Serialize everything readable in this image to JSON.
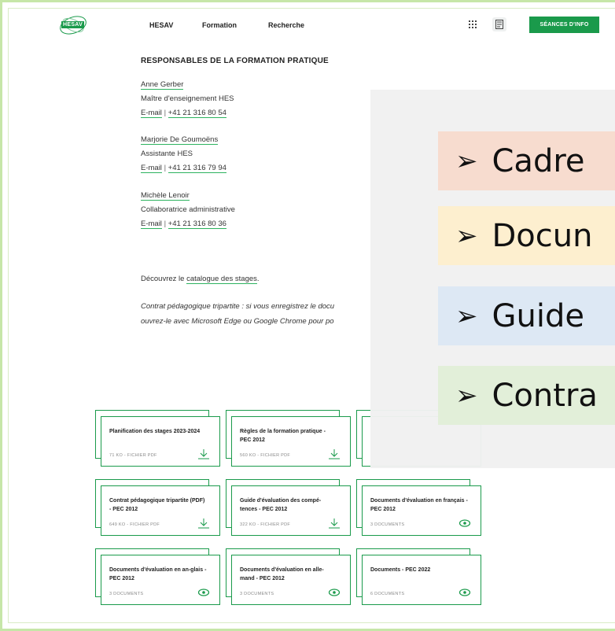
{
  "header": {
    "logo_text": "HESAV",
    "nav": [
      "HESAV",
      "Formation",
      "Recherche"
    ],
    "cta_label": "SÉANCES D'INFO"
  },
  "main": {
    "heading": "RESPONSABLES DE LA FORMATION PRATIQUE",
    "contacts": [
      {
        "name": "Anne Gerber",
        "role": "Maître d'enseignement HES",
        "email": "E-mail",
        "sep": "|",
        "phone": "+41 21 316 80 54"
      },
      {
        "name": "Marjorie De Goumoëns",
        "role": "Assistante HES",
        "email": "E-mail",
        "sep": "|",
        "phone": "+41 21 316 79 94"
      },
      {
        "name": "Michèle Lenoir",
        "role": "Collaboratrice administrative",
        "email": "E-mail",
        "sep": "|",
        "phone": "+41 21 316 80 36"
      }
    ],
    "catalogue": {
      "prefix": "Découvrez le ",
      "link": "catalogue des stages",
      "suffix": "."
    },
    "note_line1": "Contrat pédagogique tripartite : si vous enregistrez le docu",
    "note_line2": "ouvrez-le avec Microsoft Edge ou Google Chrome pour po"
  },
  "overlay": {
    "bullets": [
      "Cadre",
      "Docun",
      "Guide",
      "Contra"
    ],
    "colors": [
      "#f7dccf",
      "#fdefcf",
      "#dde8f4",
      "#e2efd9"
    ]
  },
  "cards": [
    {
      "title": "Planification des stages 2023-2024",
      "meta": "71 KO - FICHIER PDF",
      "icon": "download-icon"
    },
    {
      "title": "Règles de la formation pratique - PEC 2012",
      "meta": "560 KO - FICHIER PDF",
      "icon": "download-icon"
    },
    {
      "title": "",
      "meta": "",
      "icon": ""
    },
    {
      "title": "Contrat pédagogique tripartite (PDF) - PEC 2012",
      "meta": "649 KO - FICHIER PDF",
      "icon": "download-icon"
    },
    {
      "title": "Guide d'évaluation des compé-tences - PEC 2012",
      "meta": "322 KO - FICHIER PDF",
      "icon": "download-icon"
    },
    {
      "title": "Documents d'évaluation en français - PEC 2012",
      "meta": "3 DOCUMENTS",
      "icon": "eye-icon"
    },
    {
      "title": "Documents d'évaluation en an-glais - PEC 2012",
      "meta": "3 DOCUMENTS",
      "icon": "eye-icon"
    },
    {
      "title": "Documents d'évaluation en alle-mand - PEC 2012",
      "meta": "3 DOCUMENTS",
      "icon": "eye-icon"
    },
    {
      "title": "Documents - PEC 2022",
      "meta": "6 DOCUMENTS",
      "icon": "eye-icon"
    }
  ],
  "colors": {
    "brand": "#1a9a4b",
    "accent_underline": "#2db35f"
  }
}
